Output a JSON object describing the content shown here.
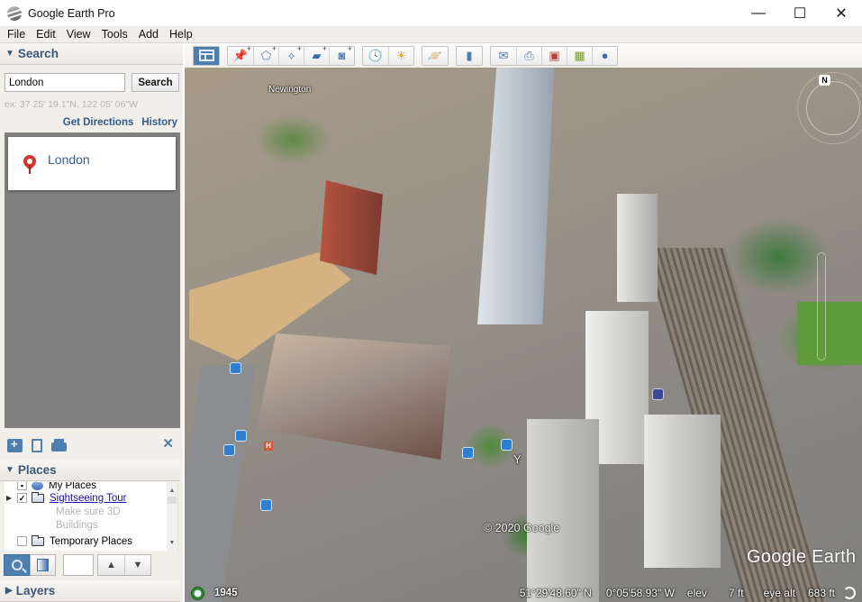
{
  "window": {
    "title": "Google Earth Pro",
    "controls": {
      "minimize": "—",
      "maximize": "☐",
      "close": "✕"
    }
  },
  "menu": [
    "File",
    "Edit",
    "View",
    "Tools",
    "Add",
    "Help"
  ],
  "search_panel": {
    "header": "Search",
    "input_value": "London",
    "search_button": "Search",
    "hint": "ex: 37 25' 19.1\"N, 122 05' 06\"W",
    "get_directions": "Get Directions",
    "history": "History",
    "results": [
      {
        "name": "London",
        "icon": "red-placemark-icon"
      }
    ]
  },
  "panel_tools": {
    "icons": [
      "add-folder-icon",
      "copy-document-icon",
      "print-icon"
    ],
    "close": "✕"
  },
  "places_panel": {
    "header": "Places",
    "tree": [
      {
        "label": "My Places",
        "icon": "globe-icon",
        "checked": false,
        "partial": true
      },
      {
        "label": "Sightseeing Tour",
        "icon": "folder-icon",
        "checked": true,
        "link": true,
        "description": [
          "Make sure 3D",
          "Buildings"
        ]
      },
      {
        "label": "Temporary Places",
        "icon": "folder-icon",
        "checked": false
      }
    ]
  },
  "nav_buttons": {
    "search_mode_icon": "magnifier-icon",
    "gradient_icon": "sidebar-toggle-icon",
    "up": "▲",
    "down": "▼"
  },
  "layers_panel": {
    "header": "Layers"
  },
  "toolbar": {
    "groups": [
      [
        {
          "name": "hide-sidebar",
          "icon": "sidebar-icon",
          "active": true
        }
      ],
      [
        {
          "name": "add-placemark",
          "icon": "pushpin-icon",
          "glyph": "📌"
        },
        {
          "name": "add-polygon",
          "icon": "polygon-icon",
          "glyph": "⬠"
        },
        {
          "name": "add-path",
          "icon": "path-icon",
          "glyph": "⟡"
        },
        {
          "name": "add-image-overlay",
          "icon": "image-overlay-icon",
          "glyph": "▰"
        },
        {
          "name": "record-tour",
          "icon": "camera-icon",
          "glyph": "◙"
        }
      ],
      [
        {
          "name": "historical-imagery",
          "icon": "clock-icon",
          "glyph": "🕓"
        },
        {
          "name": "sunlight",
          "icon": "sun-icon",
          "glyph": "☀"
        }
      ],
      [
        {
          "name": "switch-planet",
          "icon": "planet-icon",
          "glyph": "🪐"
        }
      ],
      [
        {
          "name": "ruler",
          "icon": "ruler-icon",
          "glyph": "▮"
        }
      ],
      [
        {
          "name": "email",
          "icon": "envelope-icon",
          "glyph": "✉"
        },
        {
          "name": "print",
          "icon": "printer-icon",
          "glyph": "⎙"
        },
        {
          "name": "save-image",
          "icon": "save-image-icon",
          "glyph": "▣"
        },
        {
          "name": "view-in-maps",
          "icon": "map-icon",
          "glyph": "▦"
        },
        {
          "name": "earth-gallery",
          "icon": "globe-icon",
          "glyph": "●"
        }
      ]
    ]
  },
  "map": {
    "place_label": "Newington",
    "north_indicator": "N",
    "copyright": "© 2020 Google",
    "watermark": "Google Earth",
    "poi_markers": [
      "bus-stop-icon",
      "hospital-icon",
      "bar-icon",
      "metro-icon"
    ]
  },
  "status": {
    "historical_year": "1945",
    "latitude": "51°29'48.60\" N",
    "longitude": "0°05'58.93\" W",
    "elev_label": "elev",
    "elev_value": "7 ft",
    "eye_alt_label": "eye alt",
    "eye_alt_value": "683 ft"
  }
}
